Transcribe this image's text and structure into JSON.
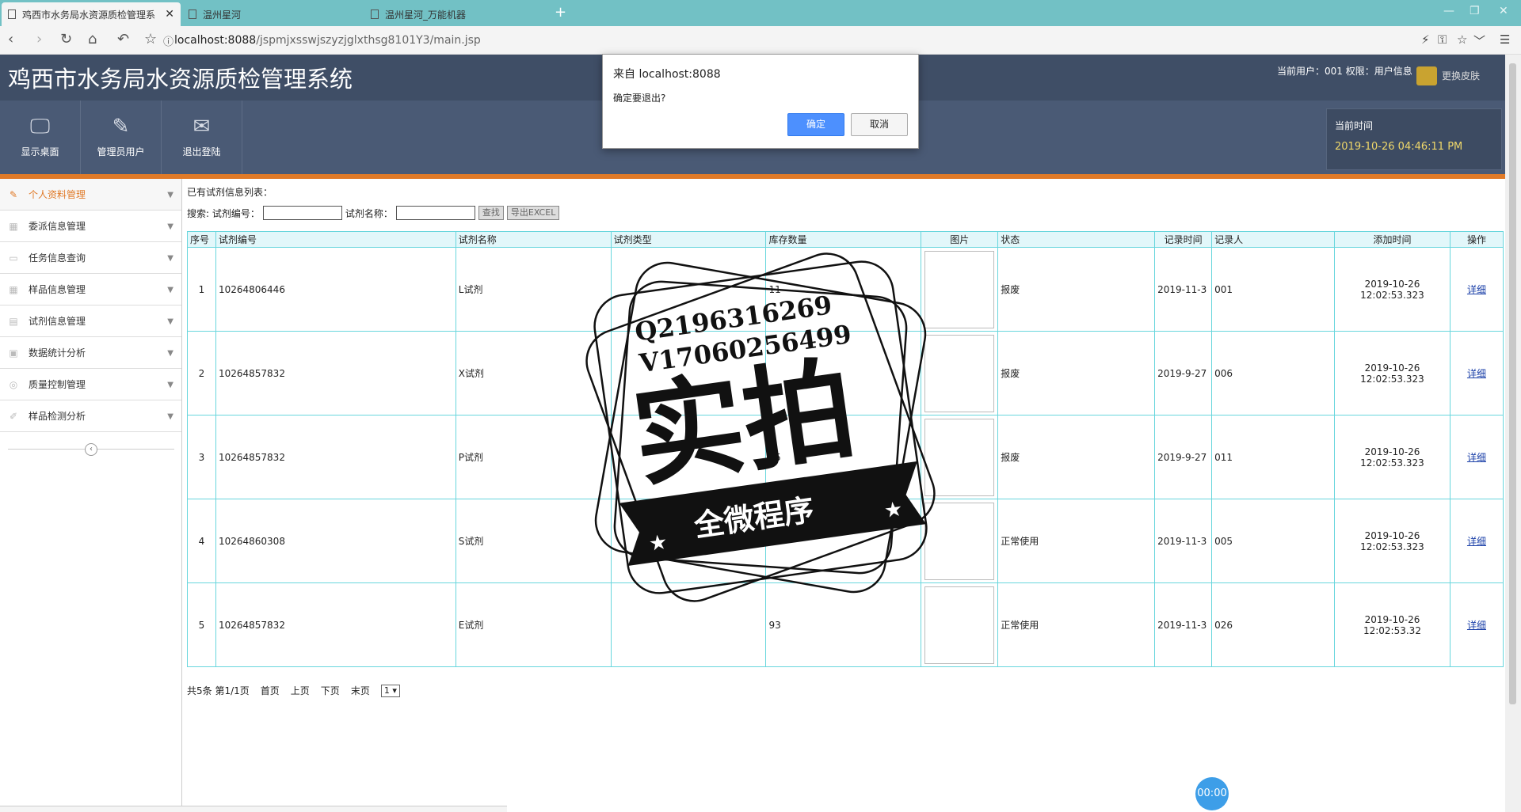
{
  "browser": {
    "tabs": [
      {
        "label": "鸡西市水务局水资源质检管理系"
      },
      {
        "label": "温州星河"
      },
      {
        "label": "温州星河_万能机器"
      }
    ],
    "new_tab": "+",
    "url_host": "localhost:8088",
    "url_path": "/jspmjxsswjszyzjglxthsg8101Y3/main.jsp"
  },
  "header": {
    "title": "鸡西市水务局水资源质检管理系统",
    "user_info": "当前用户：001  权限：用户信息",
    "skin_label": "更换皮肤"
  },
  "toolbar": {
    "items": [
      {
        "label": "显示桌面",
        "icon": "monitor-icon"
      },
      {
        "label": "管理员用户",
        "icon": "pencil-icon"
      },
      {
        "label": "退出登陆",
        "icon": "envelope-icon"
      }
    ],
    "time_label": "当前时间",
    "time_value": "2019-10-26 04:46:11 PM"
  },
  "sidebar": {
    "items": [
      {
        "label": "个人资料管理"
      },
      {
        "label": "委派信息管理"
      },
      {
        "label": "任务信息查询"
      },
      {
        "label": "样品信息管理"
      },
      {
        "label": "试剂信息管理"
      },
      {
        "label": "数据统计分析"
      },
      {
        "label": "质量控制管理"
      },
      {
        "label": "样品检测分析"
      }
    ]
  },
  "main": {
    "list_title": "已有试剂信息列表：",
    "search_prefix": "搜索: 试剂编号：",
    "search_name_label": "试剂名称：",
    "search_button": "查找",
    "export_button": "导出EXCEL",
    "columns": [
      "序号",
      "试剂编号",
      "试剂名称",
      "试剂类型",
      "库存数量",
      "图片",
      "状态",
      "记录时间",
      "记录人",
      "添加时间",
      "操作"
    ],
    "rows": [
      {
        "no": "1",
        "code": "10264806446",
        "name": "L试剂",
        "type": "",
        "qty": "11",
        "status": "报废",
        "record_time": "2019-11-3",
        "recorder": "001",
        "added": "2019-10-26 12:02:53.323",
        "action": "详细"
      },
      {
        "no": "2",
        "code": "10264857832",
        "name": "X试剂",
        "type": "",
        "qty": "",
        "status": "报废",
        "record_time": "2019-9-27",
        "recorder": "006",
        "added": "2019-10-26 12:02:53.323",
        "action": "详细"
      },
      {
        "no": "3",
        "code": "10264857832",
        "name": "P试剂",
        "type": "",
        "qty": "85",
        "status": "报废",
        "record_time": "2019-9-27",
        "recorder": "011",
        "added": "2019-10-26 12:02:53.323",
        "action": "详细"
      },
      {
        "no": "4",
        "code": "10264860308",
        "name": "S试剂",
        "type": "",
        "qty": "47",
        "status": "正常使用",
        "record_time": "2019-11-3",
        "recorder": "005",
        "added": "2019-10-26 12:02:53.323",
        "action": "详细"
      },
      {
        "no": "5",
        "code": "10264857832",
        "name": "E试剂",
        "type": "",
        "qty": "93",
        "status": "正常使用",
        "record_time": "2019-11-3",
        "recorder": "026",
        "added": "2019-10-26 12:02:53.32",
        "action": "详细"
      }
    ],
    "pager": {
      "summary": "共5条  第1/1页",
      "first": "首页",
      "prev": "上页",
      "next": "下页",
      "last": "末页",
      "page_value": "1 ▾"
    }
  },
  "dialog": {
    "title": "来自 localhost:8088",
    "message": "确定要退出?",
    "ok": "确定",
    "cancel": "取消"
  },
  "stamp": {
    "line1": "Q2196316269",
    "line2": "V17060256499",
    "main": "实拍",
    "banner": "全微程序"
  },
  "timer": "00:00",
  "colors": {
    "header_bg": "#3f4e66",
    "accent_orange": "#e07a28",
    "tab_bar": "#72c1c5",
    "grid_border": "#68d6dd",
    "ok_button": "#4d90fe"
  }
}
